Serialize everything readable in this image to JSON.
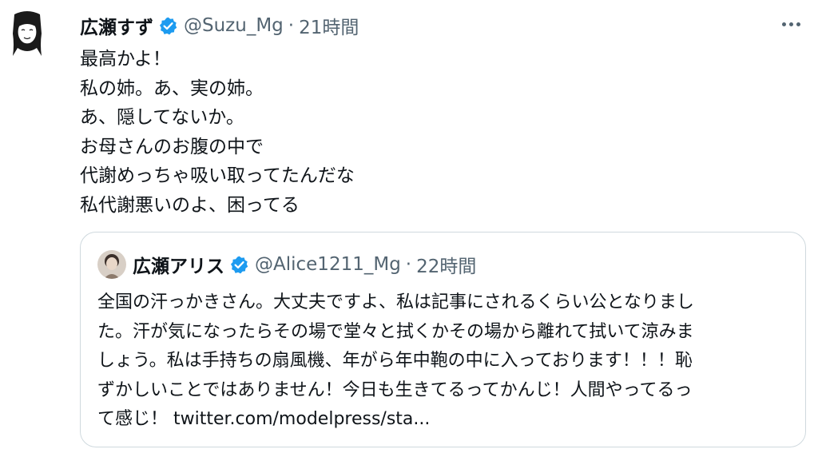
{
  "tweet": {
    "author_name": "広瀬すず",
    "author_handle": "@Suzu_Mg",
    "separator": "·",
    "time": "21時間",
    "lines": [
      "最高かよ！",
      "私の姉。あ、実の姉。",
      "あ、隠してないか。",
      "お母さんのお腹の中で",
      "代謝めっちゃ吸い取ってたんだな",
      "私代謝悪いのよ、困ってる"
    ]
  },
  "quoted_tweet": {
    "author_name": "広瀬アリス",
    "author_handle": "@Alice1211_Mg",
    "separator": "·",
    "time": "22時間",
    "lines": [
      "全国の汗っかきさん。大丈夫ですよ、私は記事にされるくらい公となりまし",
      "た。汗が気になったらその場で堂々と拭くかその場から離れて拭いて涼みま",
      "しょう。私は手持ちの扇風機、年がら年中鞄の中に入っております！！！恥",
      "ずかしいことではありません！今日も生きてるってかんじ！人間やってるっ"
    ],
    "last_line_prefix": "て感じ！ ",
    "link_text": "twitter.com/modelpress/sta..."
  },
  "icons": {
    "verified": "verified-badge-icon",
    "more": "more-dots-icon"
  },
  "colors": {
    "text": "#0f1419",
    "secondary": "#536471",
    "verified": "#1d9bf0",
    "border": "#cfd9de"
  }
}
